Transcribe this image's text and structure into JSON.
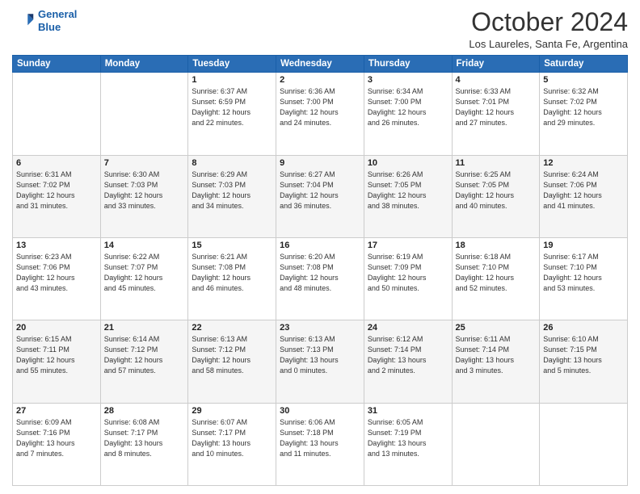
{
  "header": {
    "logo_line1": "General",
    "logo_line2": "Blue",
    "month": "October 2024",
    "location": "Los Laureles, Santa Fe, Argentina"
  },
  "days_of_week": [
    "Sunday",
    "Monday",
    "Tuesday",
    "Wednesday",
    "Thursday",
    "Friday",
    "Saturday"
  ],
  "weeks": [
    [
      {
        "day": "",
        "detail": ""
      },
      {
        "day": "",
        "detail": ""
      },
      {
        "day": "1",
        "detail": "Sunrise: 6:37 AM\nSunset: 6:59 PM\nDaylight: 12 hours\nand 22 minutes."
      },
      {
        "day": "2",
        "detail": "Sunrise: 6:36 AM\nSunset: 7:00 PM\nDaylight: 12 hours\nand 24 minutes."
      },
      {
        "day": "3",
        "detail": "Sunrise: 6:34 AM\nSunset: 7:00 PM\nDaylight: 12 hours\nand 26 minutes."
      },
      {
        "day": "4",
        "detail": "Sunrise: 6:33 AM\nSunset: 7:01 PM\nDaylight: 12 hours\nand 27 minutes."
      },
      {
        "day": "5",
        "detail": "Sunrise: 6:32 AM\nSunset: 7:02 PM\nDaylight: 12 hours\nand 29 minutes."
      }
    ],
    [
      {
        "day": "6",
        "detail": "Sunrise: 6:31 AM\nSunset: 7:02 PM\nDaylight: 12 hours\nand 31 minutes."
      },
      {
        "day": "7",
        "detail": "Sunrise: 6:30 AM\nSunset: 7:03 PM\nDaylight: 12 hours\nand 33 minutes."
      },
      {
        "day": "8",
        "detail": "Sunrise: 6:29 AM\nSunset: 7:03 PM\nDaylight: 12 hours\nand 34 minutes."
      },
      {
        "day": "9",
        "detail": "Sunrise: 6:27 AM\nSunset: 7:04 PM\nDaylight: 12 hours\nand 36 minutes."
      },
      {
        "day": "10",
        "detail": "Sunrise: 6:26 AM\nSunset: 7:05 PM\nDaylight: 12 hours\nand 38 minutes."
      },
      {
        "day": "11",
        "detail": "Sunrise: 6:25 AM\nSunset: 7:05 PM\nDaylight: 12 hours\nand 40 minutes."
      },
      {
        "day": "12",
        "detail": "Sunrise: 6:24 AM\nSunset: 7:06 PM\nDaylight: 12 hours\nand 41 minutes."
      }
    ],
    [
      {
        "day": "13",
        "detail": "Sunrise: 6:23 AM\nSunset: 7:06 PM\nDaylight: 12 hours\nand 43 minutes."
      },
      {
        "day": "14",
        "detail": "Sunrise: 6:22 AM\nSunset: 7:07 PM\nDaylight: 12 hours\nand 45 minutes."
      },
      {
        "day": "15",
        "detail": "Sunrise: 6:21 AM\nSunset: 7:08 PM\nDaylight: 12 hours\nand 46 minutes."
      },
      {
        "day": "16",
        "detail": "Sunrise: 6:20 AM\nSunset: 7:08 PM\nDaylight: 12 hours\nand 48 minutes."
      },
      {
        "day": "17",
        "detail": "Sunrise: 6:19 AM\nSunset: 7:09 PM\nDaylight: 12 hours\nand 50 minutes."
      },
      {
        "day": "18",
        "detail": "Sunrise: 6:18 AM\nSunset: 7:10 PM\nDaylight: 12 hours\nand 52 minutes."
      },
      {
        "day": "19",
        "detail": "Sunrise: 6:17 AM\nSunset: 7:10 PM\nDaylight: 12 hours\nand 53 minutes."
      }
    ],
    [
      {
        "day": "20",
        "detail": "Sunrise: 6:15 AM\nSunset: 7:11 PM\nDaylight: 12 hours\nand 55 minutes."
      },
      {
        "day": "21",
        "detail": "Sunrise: 6:14 AM\nSunset: 7:12 PM\nDaylight: 12 hours\nand 57 minutes."
      },
      {
        "day": "22",
        "detail": "Sunrise: 6:13 AM\nSunset: 7:12 PM\nDaylight: 12 hours\nand 58 minutes."
      },
      {
        "day": "23",
        "detail": "Sunrise: 6:13 AM\nSunset: 7:13 PM\nDaylight: 13 hours\nand 0 minutes."
      },
      {
        "day": "24",
        "detail": "Sunrise: 6:12 AM\nSunset: 7:14 PM\nDaylight: 13 hours\nand 2 minutes."
      },
      {
        "day": "25",
        "detail": "Sunrise: 6:11 AM\nSunset: 7:14 PM\nDaylight: 13 hours\nand 3 minutes."
      },
      {
        "day": "26",
        "detail": "Sunrise: 6:10 AM\nSunset: 7:15 PM\nDaylight: 13 hours\nand 5 minutes."
      }
    ],
    [
      {
        "day": "27",
        "detail": "Sunrise: 6:09 AM\nSunset: 7:16 PM\nDaylight: 13 hours\nand 7 minutes."
      },
      {
        "day": "28",
        "detail": "Sunrise: 6:08 AM\nSunset: 7:17 PM\nDaylight: 13 hours\nand 8 minutes."
      },
      {
        "day": "29",
        "detail": "Sunrise: 6:07 AM\nSunset: 7:17 PM\nDaylight: 13 hours\nand 10 minutes."
      },
      {
        "day": "30",
        "detail": "Sunrise: 6:06 AM\nSunset: 7:18 PM\nDaylight: 13 hours\nand 11 minutes."
      },
      {
        "day": "31",
        "detail": "Sunrise: 6:05 AM\nSunset: 7:19 PM\nDaylight: 13 hours\nand 13 minutes."
      },
      {
        "day": "",
        "detail": ""
      },
      {
        "day": "",
        "detail": ""
      }
    ]
  ]
}
